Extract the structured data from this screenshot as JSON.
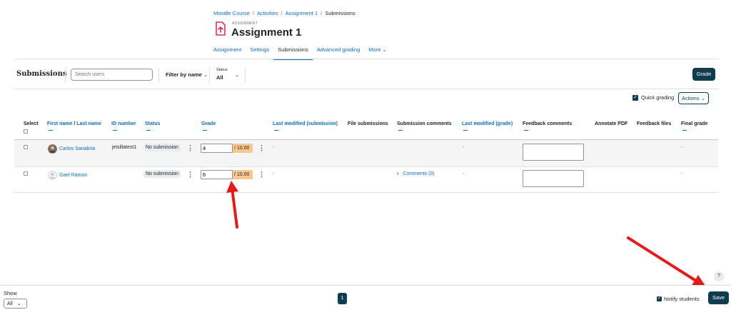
{
  "breadcrumb": [
    "Moodle Course",
    "Activities",
    "Assignment 1",
    "Submissions"
  ],
  "assignment": {
    "kicker": "ASSIGNMENT",
    "title": "Assignment 1"
  },
  "tabs": [
    "Assignment",
    "Settings",
    "Submissions",
    "Advanced grading",
    "More"
  ],
  "tabs_active": "Submissions",
  "toolbar": {
    "title": "Submissions",
    "search_placeholder": "Search users",
    "filter_label": "Filter by name",
    "status_label": "Status",
    "status_value": "All",
    "grade_button": "Grade"
  },
  "options": {
    "quick_grading": "Quick grading",
    "actions": "Actions"
  },
  "table": {
    "headers": {
      "select": "Select",
      "first_name": "First name",
      "name_sep": "/",
      "last_name": "Last name",
      "id_number": "ID number",
      "status": "Status",
      "grade": "Grade",
      "last_modified_submission": "Last modified (submission)",
      "file_submissions": "File submissions",
      "submission_comments": "Submission comments",
      "last_modified_grade": "Last modified (grade)",
      "feedback_comments": "Feedback comments",
      "annotate_pdf": "Annotate PDF",
      "feedback_files": "Feedback files",
      "final_grade": "Final grade"
    },
    "rows": [
      {
        "name": "Carlos Sanabria",
        "id_number": "jeisillatest1",
        "status": "No submission",
        "grade": "4",
        "grade_max": "/ 10.00",
        "last_modified_submission": "-",
        "submission_comments": "",
        "last_modified_grade": "-",
        "final_grade": "-"
      },
      {
        "name": "Gael Ramon",
        "id_number": "",
        "status": "No submission",
        "grade": "6",
        "grade_max": "/ 10.00",
        "last_modified_submission": "-",
        "submission_comments": "Comments (0)",
        "last_modified_grade": "-",
        "final_grade": "-"
      }
    ]
  },
  "footer": {
    "show_label": "Show",
    "show_value": "All",
    "page": "1",
    "notify_students": "Notify students",
    "save_button": "Save",
    "help": "?"
  },
  "colors": {
    "primary": "#0f3d4f",
    "link": "#0f6cbf",
    "grade_highlight": "#f9c78f",
    "annotation_arrow": "#e31b1b",
    "assignment_icon": "#d9305a"
  }
}
